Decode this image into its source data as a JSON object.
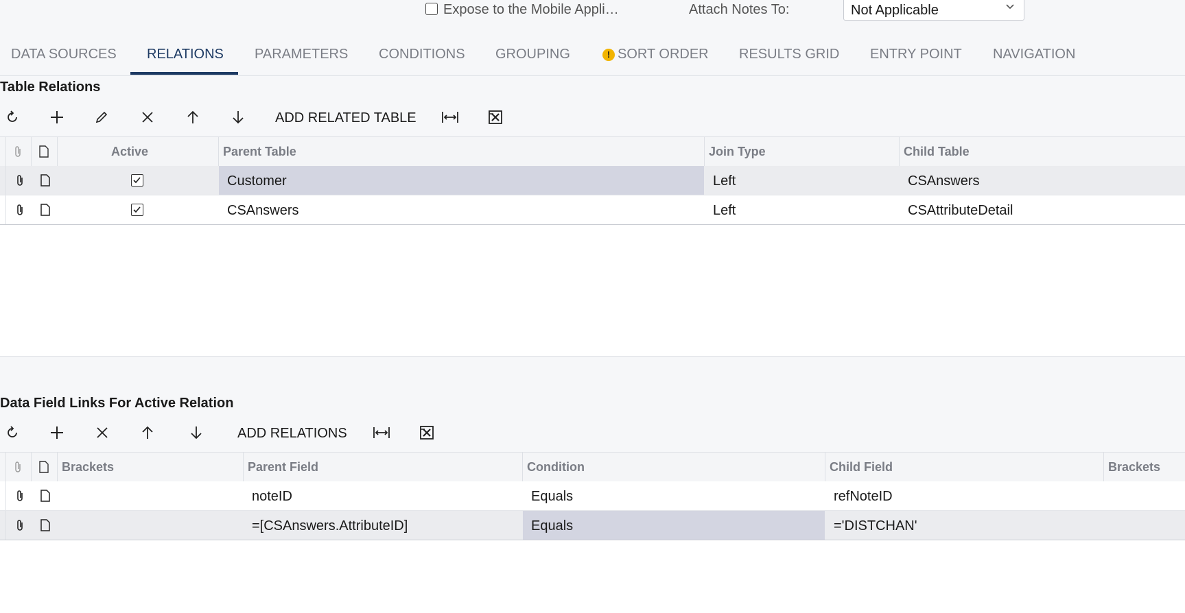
{
  "top": {
    "expose_label": "Expose to the Mobile Appli…",
    "attach_label": "Attach Notes To:",
    "attach_value": "Not Applicable"
  },
  "tabs": [
    {
      "label": "DATA SOURCES"
    },
    {
      "label": "RELATIONS"
    },
    {
      "label": "PARAMETERS"
    },
    {
      "label": "CONDITIONS"
    },
    {
      "label": "GROUPING"
    },
    {
      "label": "SORT ORDER"
    },
    {
      "label": "RESULTS GRID"
    },
    {
      "label": "ENTRY POINT"
    },
    {
      "label": "NAVIGATION"
    }
  ],
  "table_relations": {
    "title": "Table Relations",
    "add_button": "ADD RELATED TABLE",
    "headers": {
      "active": "Active",
      "parent": "Parent Table",
      "join": "Join Type",
      "child": "Child Table"
    },
    "rows": [
      {
        "active": true,
        "parent": "Customer",
        "join": "Left",
        "child": "CSAnswers"
      },
      {
        "active": true,
        "parent": "CSAnswers",
        "join": "Left",
        "child": "CSAttributeDetail"
      }
    ]
  },
  "field_links": {
    "title": "Data Field Links For Active Relation",
    "add_button": "ADD RELATIONS",
    "headers": {
      "brackets_open": "Brackets",
      "parent": "Parent Field",
      "condition": "Condition",
      "child": "Child Field",
      "brackets_close": "Brackets"
    },
    "rows": [
      {
        "brackets_open": "",
        "parent": "noteID",
        "condition": "Equals",
        "child": "refNoteID",
        "brackets_close": ""
      },
      {
        "brackets_open": "",
        "parent": "=[CSAnswers.AttributeID]",
        "condition": "Equals",
        "child": "='DISTCHAN'",
        "brackets_close": ""
      }
    ]
  },
  "colors": {
    "accent": "#1d3a63",
    "highlight": "#d3d5e1",
    "warning": "#f2b400"
  }
}
